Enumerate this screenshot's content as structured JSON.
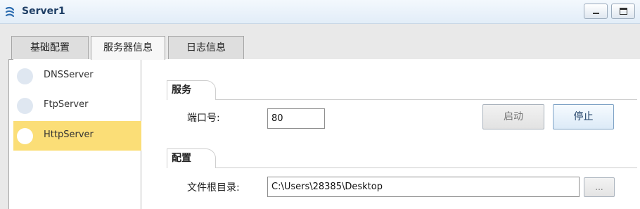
{
  "window": {
    "title": "Server1",
    "icon": "server-network-icon"
  },
  "tabs": [
    {
      "label": "基础配置",
      "active": false
    },
    {
      "label": "服务器信息",
      "active": true
    },
    {
      "label": "日志信息",
      "active": false
    }
  ],
  "sidebar": {
    "items": [
      {
        "label": "DNSServer",
        "selected": false
      },
      {
        "label": "FtpServer",
        "selected": false
      },
      {
        "label": "HttpServer",
        "selected": true
      }
    ],
    "selected_color": "#fbde77"
  },
  "service_group": {
    "title": "服务",
    "port_label": "端口号:",
    "port_value": "80",
    "start_label": "启动",
    "stop_label": "停止"
  },
  "config_group": {
    "title": "配置",
    "root_dir_label": "文件根目录:",
    "root_dir_value": "C:\\Users\\28385\\Desktop",
    "browse_label": "..."
  }
}
